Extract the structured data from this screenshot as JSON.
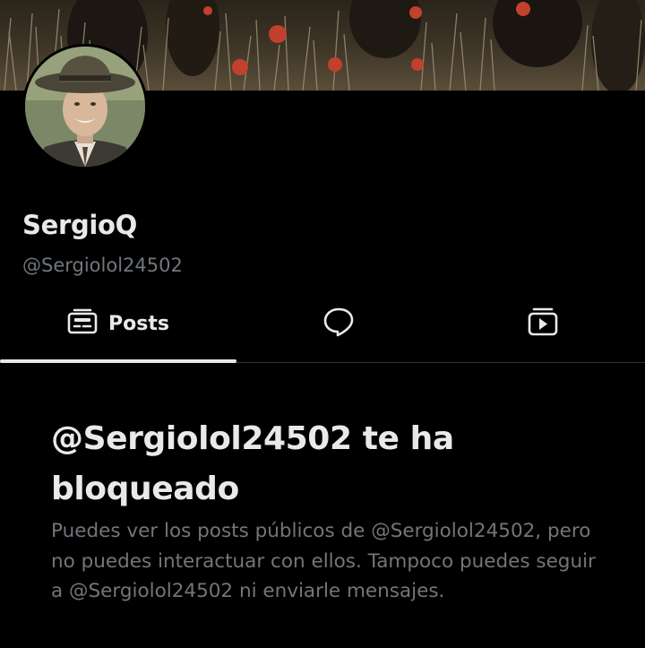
{
  "profile": {
    "display_name": "SergioQ",
    "handle": "@Sergiolol24502"
  },
  "tabs": [
    {
      "label": "Posts",
      "icon": "posts-icon",
      "selected": true
    },
    {
      "label": "",
      "icon": "replies-icon",
      "selected": false
    },
    {
      "label": "",
      "icon": "media-icon",
      "selected": false
    }
  ],
  "blocked_notice": {
    "title": "@Sergiolol24502 te ha bloqueado",
    "description": "Puedes ver los posts públicos de @Sergiolol24502, pero no puedes interactuar con ellos. Tampoco puedes seguir a @Sergiolol24502 ni enviarle mensajes."
  },
  "colors": {
    "background": "#000000",
    "primary_text": "#e7e9ea",
    "secondary_text": "#71767b",
    "divider": "#2f3336"
  }
}
